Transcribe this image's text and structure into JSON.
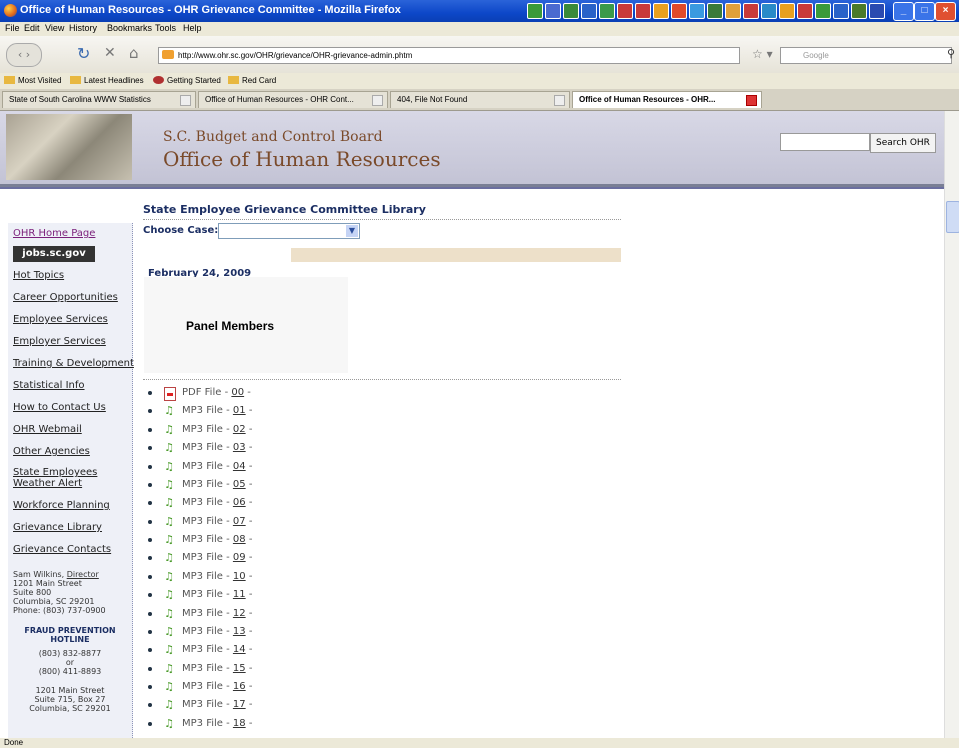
{
  "window": {
    "title": "Office of Human Resources - OHR Grievance Committee - Mozilla Firefox",
    "controls": [
      "_",
      "□",
      "×"
    ]
  },
  "menu": [
    "File",
    "Edit",
    "View",
    "History",
    "Bookmarks",
    "Tools",
    "Help"
  ],
  "toolbar": {
    "url": "http://www.ohr.sc.gov/OHR/grievance/OHR-grievance-admin.phtm",
    "search_placeholder": "Google"
  },
  "bookmarks": [
    "Most Visited",
    "Latest Headlines",
    "Getting Started",
    "Red Card"
  ],
  "tabs": [
    {
      "label": "State of South Carolina WWW Statistics",
      "active": false
    },
    {
      "label": "Office of Human Resources - OHR Cont...",
      "active": false
    },
    {
      "label": "404, File Not Found",
      "active": false
    },
    {
      "label": "Office of Human Resources - OHR...",
      "active": true
    }
  ],
  "header": {
    "board": "S.C. Budget and Control Board",
    "office": "Office of Human Resources",
    "search_button": "Search OHR"
  },
  "sidebar": {
    "links": [
      "OHR Home Page",
      "Hot Topics",
      "Career Opportunities",
      "Employee Services",
      "Employer Services",
      "Training & Development",
      "Statistical Info",
      "How to Contact Us",
      "OHR Webmail",
      "Other Agencies",
      "State Employees",
      "Weather Alert",
      "Workforce Planning",
      "Grievance Library",
      "Grievance Contacts"
    ],
    "jobs_label": "jobs.sc.gov",
    "address": {
      "name": "Sam Wilkins,",
      "title": "Director",
      "line1": "1201 Main Street",
      "line2": "Suite 800",
      "line3": "Columbia, SC 29201",
      "phone": "Phone: (803) 737-0900"
    },
    "fraud": {
      "heading1": "FRAUD PREVENTION",
      "heading2": "HOTLINE",
      "phone1": "(803) 832-8877",
      "or": "or",
      "phone2": "(800) 411-8893",
      "addr1": "1201 Main Street",
      "addr2": "Suite 715, Box 27",
      "addr3": "Columbia, SC 29201"
    }
  },
  "main": {
    "library_title": "State Employee Grievance Committee Library",
    "choose_case_label": "Choose Case:",
    "date": "February 24, 2009",
    "panel_members": "Panel Members",
    "files": [
      {
        "type": "PDF File",
        "num": "00",
        "sep": " - ",
        "dash": " -"
      },
      {
        "type": "MP3 File",
        "num": "01",
        "sep": " - ",
        "dash": " -"
      },
      {
        "type": "MP3 File",
        "num": "02",
        "sep": " - ",
        "dash": " -"
      },
      {
        "type": "MP3 File",
        "num": "03",
        "sep": " - ",
        "dash": " -"
      },
      {
        "type": "MP3 File",
        "num": "04",
        "sep": " - ",
        "dash": " -"
      },
      {
        "type": "MP3 File",
        "num": "05",
        "sep": " - ",
        "dash": " -"
      },
      {
        "type": "MP3 File",
        "num": "06",
        "sep": " - ",
        "dash": " -"
      },
      {
        "type": "MP3 File",
        "num": "07",
        "sep": " - ",
        "dash": " -"
      },
      {
        "type": "MP3 File",
        "num": "08",
        "sep": " - ",
        "dash": " -"
      },
      {
        "type": "MP3 File",
        "num": "09",
        "sep": " - ",
        "dash": " -"
      },
      {
        "type": "MP3 File",
        "num": "10",
        "sep": " - ",
        "dash": " -"
      },
      {
        "type": "MP3 File",
        "num": "11",
        "sep": " - ",
        "dash": " -"
      },
      {
        "type": "MP3 File",
        "num": "12",
        "sep": " - ",
        "dash": " -"
      },
      {
        "type": "MP3 File",
        "num": "13",
        "sep": " - ",
        "dash": " -"
      },
      {
        "type": "MP3 File",
        "num": "14",
        "sep": " - ",
        "dash": " -"
      },
      {
        "type": "MP3 File",
        "num": "15",
        "sep": " - ",
        "dash": " -"
      },
      {
        "type": "MP3 File",
        "num": "16",
        "sep": " - ",
        "dash": " -"
      },
      {
        "type": "MP3 File",
        "num": "17",
        "sep": " - ",
        "dash": " -"
      },
      {
        "type": "MP3 File",
        "num": "18",
        "sep": " - ",
        "dash": " -"
      }
    ]
  },
  "status": "Done"
}
